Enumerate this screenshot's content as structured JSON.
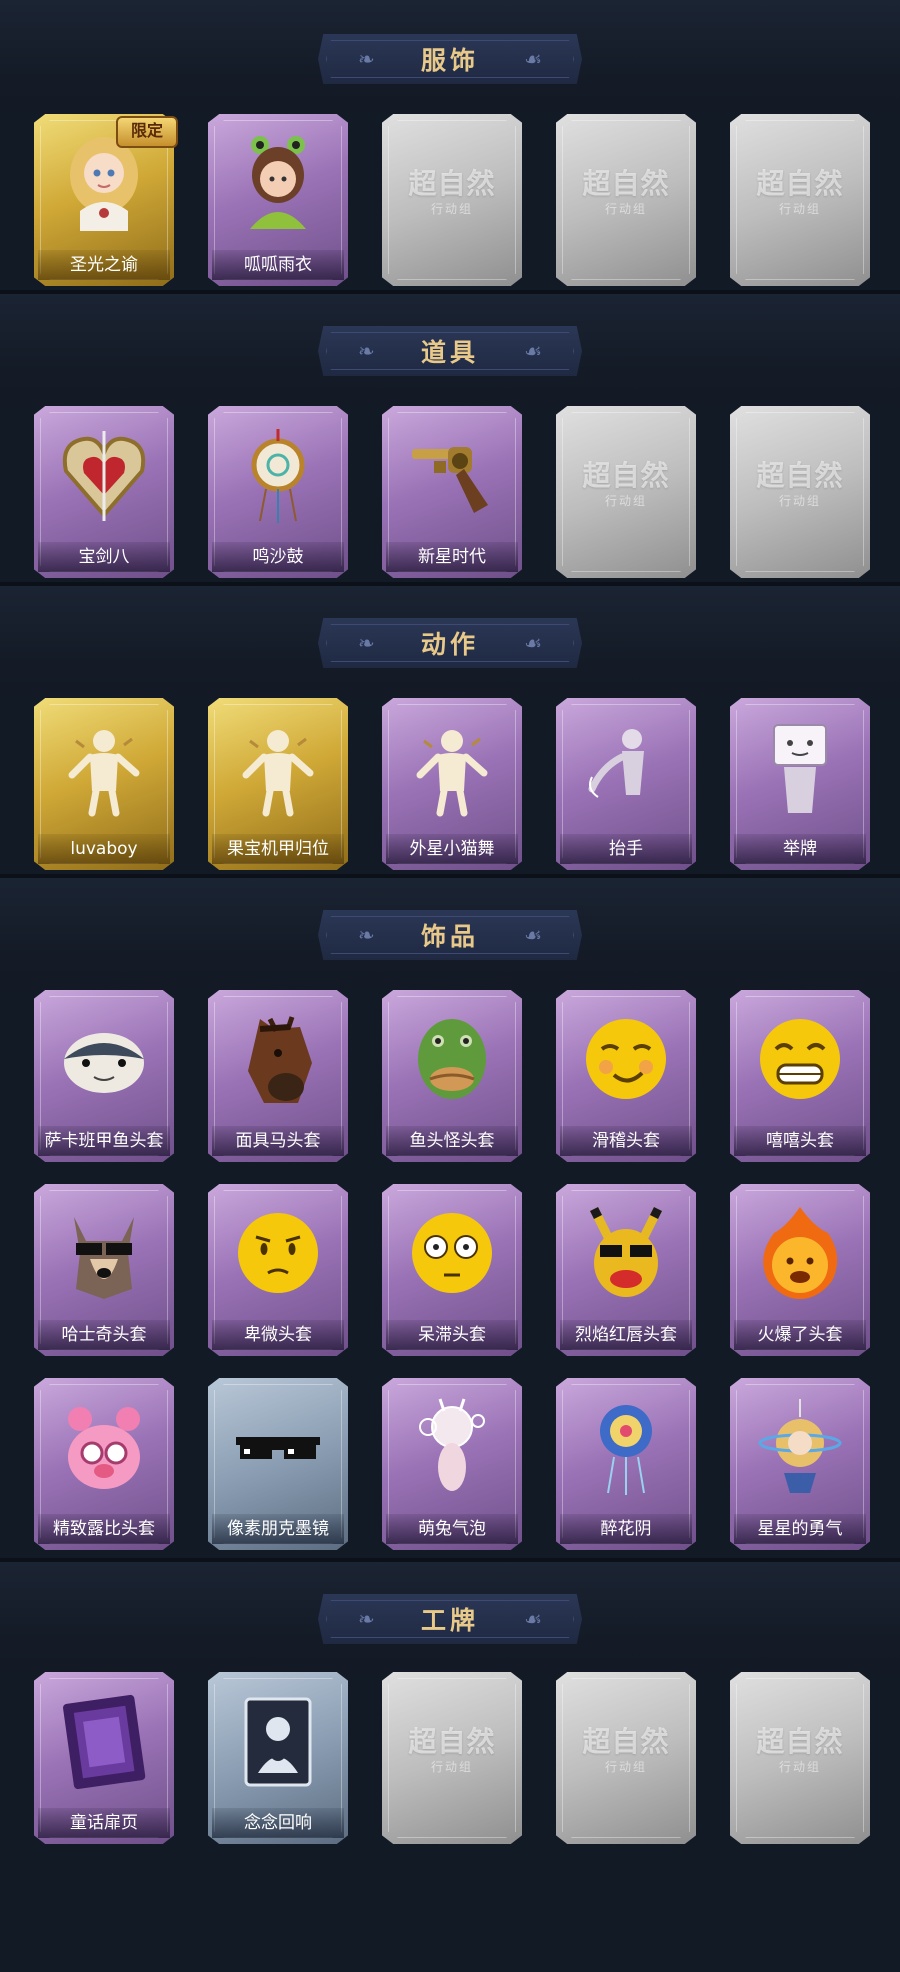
{
  "placeholder": {
    "logo": "超自然",
    "sub": "行动组"
  },
  "sections": [
    {
      "title": "服饰",
      "rows": [
        [
          {
            "label": "圣光之谕",
            "rarity": "gold",
            "badge": "限定",
            "icon": "angel-girl-icon"
          },
          {
            "label": "呱呱雨衣",
            "rarity": "purple",
            "icon": "frog-raincoat-girl-icon"
          },
          {
            "label": "",
            "rarity": "grey",
            "placeholder": true
          },
          {
            "label": "",
            "rarity": "grey",
            "placeholder": true
          },
          {
            "label": "",
            "rarity": "grey",
            "placeholder": true
          }
        ]
      ]
    },
    {
      "title": "道具",
      "rows": [
        [
          {
            "label": "宝剑八",
            "rarity": "purple",
            "icon": "heart-shield-icon"
          },
          {
            "label": "鸣沙鼓",
            "rarity": "purple",
            "icon": "sand-drum-icon"
          },
          {
            "label": "新星时代",
            "rarity": "purple",
            "icon": "revolver-icon"
          },
          {
            "label": "",
            "rarity": "grey",
            "placeholder": true
          },
          {
            "label": "",
            "rarity": "grey",
            "placeholder": true
          }
        ]
      ]
    },
    {
      "title": "动作",
      "rows": [
        [
          {
            "label": "luvaboy",
            "rarity": "gold",
            "icon": "pose-figure-icon"
          },
          {
            "label": "果宝机甲归位",
            "rarity": "gold",
            "icon": "pose-figure-icon"
          },
          {
            "label": "外星小猫舞",
            "rarity": "purple",
            "icon": "pose-figure-icon"
          },
          {
            "label": "抬手",
            "rarity": "purple",
            "icon": "raise-hand-icon"
          },
          {
            "label": "举牌",
            "rarity": "purple",
            "icon": "sign-holder-icon"
          }
        ]
      ]
    },
    {
      "title": "饰品",
      "rows": [
        [
          {
            "label": "萨卡班甲鱼头套",
            "rarity": "purple",
            "icon": "fish-head-icon"
          },
          {
            "label": "面具马头套",
            "rarity": "purple",
            "icon": "horse-mask-icon"
          },
          {
            "label": "鱼头怪头套",
            "rarity": "purple",
            "icon": "fish-monster-icon"
          },
          {
            "label": "滑稽头套",
            "rarity": "purple",
            "icon": "funny-emoji-icon"
          },
          {
            "label": "嘻嘻头套",
            "rarity": "purple",
            "icon": "grin-emoji-icon"
          }
        ],
        [
          {
            "label": "哈士奇头套",
            "rarity": "purple",
            "icon": "husky-sunglasses-icon"
          },
          {
            "label": "卑微头套",
            "rarity": "purple",
            "icon": "humble-emoji-icon"
          },
          {
            "label": "呆滞头套",
            "rarity": "purple",
            "icon": "stunned-emoji-icon"
          },
          {
            "label": "烈焰红唇头套",
            "rarity": "purple",
            "icon": "pikachu-sunglasses-icon"
          },
          {
            "label": "火爆了头套",
            "rarity": "purple",
            "icon": "fire-face-icon"
          }
        ],
        [
          {
            "label": "精致露比头套",
            "rarity": "purple",
            "icon": "pink-creature-icon"
          },
          {
            "label": "像素朋克墨镜",
            "rarity": "blue",
            "icon": "pixel-sunglasses-icon"
          },
          {
            "label": "萌兔气泡",
            "rarity": "purple",
            "icon": "bunny-bubble-icon"
          },
          {
            "label": "醉花阴",
            "rarity": "purple",
            "icon": "flower-pendant-icon"
          },
          {
            "label": "星星的勇气",
            "rarity": "purple",
            "icon": "star-charm-icon"
          }
        ]
      ]
    },
    {
      "title": "工牌",
      "rows": [
        [
          {
            "label": "童话扉页",
            "rarity": "purple",
            "icon": "storybook-card-icon"
          },
          {
            "label": "念念回响",
            "rarity": "blue",
            "icon": "portrait-card-icon"
          },
          {
            "label": "",
            "rarity": "grey",
            "placeholder": true
          },
          {
            "label": "",
            "rarity": "grey",
            "placeholder": true
          },
          {
            "label": "",
            "rarity": "grey",
            "placeholder": true
          }
        ]
      ]
    }
  ],
  "colors": {
    "background": "#121a26",
    "banner": "#25304d",
    "title_gold": "#e9c98a",
    "purple": "#9a73b6",
    "gold": "#d0a937",
    "grey": "#bdbdbd",
    "blue": "#8a9db2"
  }
}
